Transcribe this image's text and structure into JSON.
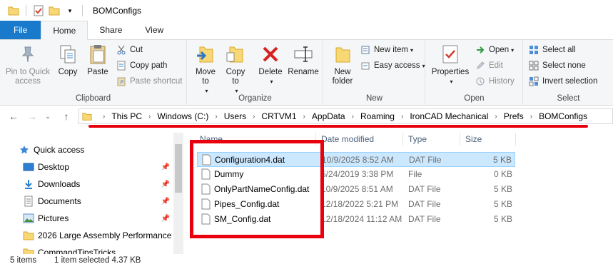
{
  "window": {
    "title": "BOMConfigs"
  },
  "tabs": [
    {
      "label": "File"
    },
    {
      "label": "Home"
    },
    {
      "label": "Share"
    },
    {
      "label": "View"
    }
  ],
  "ribbon": {
    "clipboard": {
      "label": "Clipboard",
      "pin": "Pin to Quick access",
      "copy": "Copy",
      "paste": "Paste",
      "cut": "Cut",
      "copy_path": "Copy path",
      "paste_shortcut": "Paste shortcut"
    },
    "organize": {
      "label": "Organize",
      "move_to": "Move to",
      "copy_to": "Copy to",
      "delete": "Delete",
      "rename": "Rename"
    },
    "new": {
      "label": "New",
      "new_folder": "New folder",
      "new_item": "New item",
      "easy_access": "Easy access"
    },
    "open": {
      "label": "Open",
      "properties": "Properties",
      "open": "Open",
      "edit": "Edit",
      "history": "History"
    },
    "select": {
      "label": "Select",
      "select_all": "Select all",
      "select_none": "Select none",
      "invert_selection": "Invert selection"
    }
  },
  "address": {
    "crumbs": [
      "This PC",
      "Windows (C:)",
      "Users",
      "CRTVM1",
      "AppData",
      "Roaming",
      "IronCAD Mechanical",
      "Prefs",
      "BOMConfigs"
    ]
  },
  "nav": {
    "items": [
      {
        "label": "Quick access",
        "icon": "star-icon",
        "pinned": false
      },
      {
        "label": "Desktop",
        "icon": "desktop-icon",
        "pinned": true
      },
      {
        "label": "Downloads",
        "icon": "download-icon",
        "pinned": true
      },
      {
        "label": "Documents",
        "icon": "documents-icon",
        "pinned": true
      },
      {
        "label": "Pictures",
        "icon": "pictures-icon",
        "pinned": true
      },
      {
        "label": "2026 Large Assembly Performance",
        "icon": "folder-icon",
        "pinned": false
      },
      {
        "label": "CommandTipsTricks",
        "icon": "folder-icon",
        "pinned": false
      }
    ]
  },
  "list": {
    "columns": {
      "name": "Name",
      "date": "Date modified",
      "type": "Type",
      "size": "Size"
    },
    "files": [
      {
        "name": "Configuration4.dat",
        "date": "10/9/2025 8:52 AM",
        "type": "DAT File",
        "size": "5 KB",
        "selected": true
      },
      {
        "name": "Dummy",
        "date": "5/24/2019 3:38 PM",
        "type": "File",
        "size": "0 KB",
        "selected": false
      },
      {
        "name": "OnlyPartNameConfig.dat",
        "date": "10/9/2025 8:51 AM",
        "type": "DAT File",
        "size": "5 KB",
        "selected": false
      },
      {
        "name": "Pipes_Config.dat",
        "date": "12/18/2022 5:21 PM",
        "type": "DAT File",
        "size": "5 KB",
        "selected": false
      },
      {
        "name": "SM_Config.dat",
        "date": "12/18/2024 11:12 AM",
        "type": "DAT File",
        "size": "5 KB",
        "selected": false
      }
    ]
  },
  "status": {
    "items": "5 items",
    "selected": "1 item selected  4.37 KB"
  },
  "colors": {
    "accent": "#1979ca",
    "selection": "#cce8ff",
    "highlight": "#e8000d",
    "folder": "#f8d775"
  }
}
